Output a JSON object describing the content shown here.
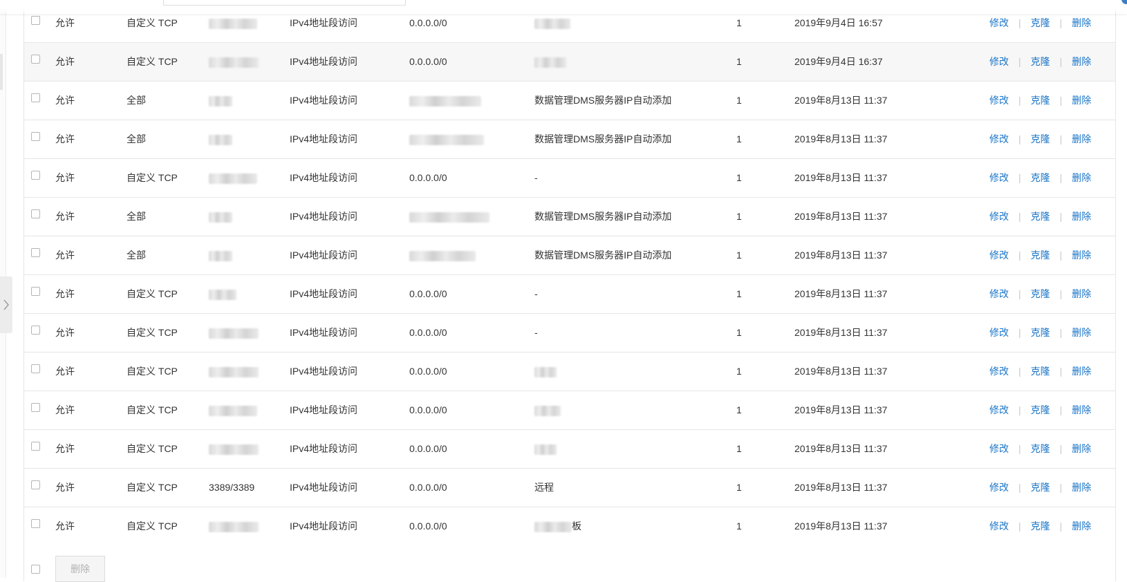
{
  "table": {
    "rows": [
      {
        "policy": "允许",
        "protocol": "自定义 TCP",
        "port": "",
        "auth_type": "IPv4地址段访问",
        "source": "0.0.0.0/0",
        "description": "",
        "priority": "1",
        "created": "2019年9月4日 16:57",
        "highlighted": false
      },
      {
        "policy": "允许",
        "protocol": "自定义 TCP",
        "port": "",
        "auth_type": "IPv4地址段访问",
        "source": "0.0.0.0/0",
        "description": "",
        "priority": "1",
        "created": "2019年9月4日 16:37",
        "highlighted": true
      },
      {
        "policy": "允许",
        "protocol": "全部",
        "port": "",
        "auth_type": "IPv4地址段访问",
        "source": "",
        "description": "数据管理DMS服务器IP自动添加",
        "priority": "1",
        "created": "2019年8月13日 11:37",
        "highlighted": false
      },
      {
        "policy": "允许",
        "protocol": "全部",
        "port": "",
        "auth_type": "IPv4地址段访问",
        "source": "",
        "description": "数据管理DMS服务器IP自动添加",
        "priority": "1",
        "created": "2019年8月13日 11:37",
        "highlighted": false
      },
      {
        "policy": "允许",
        "protocol": "自定义 TCP",
        "port": "",
        "auth_type": "IPv4地址段访问",
        "source": "0.0.0.0/0",
        "description": "-",
        "priority": "1",
        "created": "2019年8月13日 11:37",
        "highlighted": false
      },
      {
        "policy": "允许",
        "protocol": "全部",
        "port": "",
        "auth_type": "IPv4地址段访问",
        "source": "",
        "description": "数据管理DMS服务器IP自动添加",
        "priority": "1",
        "created": "2019年8月13日 11:37",
        "highlighted": false
      },
      {
        "policy": "允许",
        "protocol": "全部",
        "port": "",
        "auth_type": "IPv4地址段访问",
        "source": "",
        "description": "数据管理DMS服务器IP自动添加",
        "priority": "1",
        "created": "2019年8月13日 11:37",
        "highlighted": false
      },
      {
        "policy": "允许",
        "protocol": "自定义 TCP",
        "port": "",
        "auth_type": "IPv4地址段访问",
        "source": "0.0.0.0/0",
        "description": "-",
        "priority": "1",
        "created": "2019年8月13日 11:37",
        "highlighted": false
      },
      {
        "policy": "允许",
        "protocol": "自定义 TCP",
        "port": "",
        "auth_type": "IPv4地址段访问",
        "source": "0.0.0.0/0",
        "description": "-",
        "priority": "1",
        "created": "2019年8月13日 11:37",
        "highlighted": false
      },
      {
        "policy": "允许",
        "protocol": "自定义 TCP",
        "port": "",
        "auth_type": "IPv4地址段访问",
        "source": "0.0.0.0/0",
        "description": "",
        "priority": "1",
        "created": "2019年8月13日 11:37",
        "highlighted": false
      },
      {
        "policy": "允许",
        "protocol": "自定义 TCP",
        "port": "",
        "auth_type": "IPv4地址段访问",
        "source": "0.0.0.0/0",
        "description": "",
        "priority": "1",
        "created": "2019年8月13日 11:37",
        "highlighted": false
      },
      {
        "policy": "允许",
        "protocol": "自定义 TCP",
        "port": "",
        "auth_type": "IPv4地址段访问",
        "source": "0.0.0.0/0",
        "description": "",
        "priority": "1",
        "created": "2019年8月13日 11:37",
        "highlighted": false
      },
      {
        "policy": "允许",
        "protocol": "自定义 TCP",
        "port": "3389/3389",
        "auth_type": "IPv4地址段访问",
        "source": "0.0.0.0/0",
        "description": "远程",
        "priority": "1",
        "created": "2019年8月13日 11:37",
        "highlighted": false
      },
      {
        "policy": "允许",
        "protocol": "自定义 TCP",
        "port": "",
        "auth_type": "IPv4地址段访问",
        "source": "0.0.0.0/0",
        "description": "板",
        "priority": "1",
        "created": "2019年8月13日 11:37",
        "highlighted": false
      }
    ],
    "actions": {
      "edit": "修改",
      "clone": "克隆",
      "delete": "删除",
      "separator": "|"
    }
  },
  "footer": {
    "bulk_delete_label": "删除"
  },
  "colors": {
    "link": "#1a75c8",
    "border": "#e6e6e6",
    "hover_row": "#f7f7f7",
    "text": "#333333"
  },
  "icons": {
    "collapse_tab": "chevron-right-icon",
    "row_select": "checkbox-icon"
  }
}
